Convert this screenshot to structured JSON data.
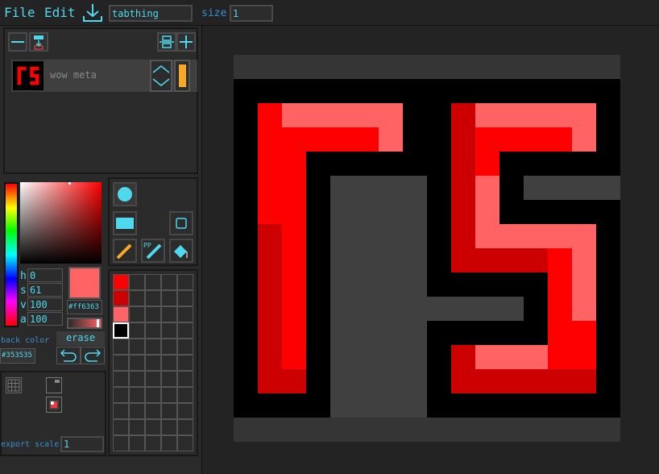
{
  "menu": {
    "file": "File",
    "edit": "Edit"
  },
  "toolbar": {
    "download_icon": "download-icon",
    "project_name": "tabthing",
    "size_label": "size",
    "size_value": "1"
  },
  "layers": {
    "toolbar": {
      "remove_icon": "minus-icon",
      "merge_icon": "merge-down-icon",
      "swap_icon": "swap-icon",
      "add_icon": "plus-icon"
    },
    "items": [
      {
        "name": "wow meta",
        "visible_color": "#f8a825"
      }
    ]
  },
  "color_picker": {
    "h_label": "h",
    "h": "0",
    "s_label": "s",
    "s": "61",
    "v_label": "v",
    "v": "100",
    "a_label": "a",
    "a": "100",
    "current_hex": "#ff6363",
    "back_color_label": "back color",
    "back_color_hex": "#353535"
  },
  "actions": {
    "erase": "erase",
    "undo_icon": "undo-icon",
    "redo_icon": "redo-icon"
  },
  "tools": [
    {
      "icon": "circle-brush-icon",
      "selected": true
    },
    {
      "icon": "square-brush-icon",
      "selected": false
    },
    {
      "icon": "small-square-brush-icon",
      "selected": false
    },
    {
      "icon": "pencil-icon",
      "selected": false
    },
    {
      "icon": "pixel-perfect-pencil-icon",
      "label": "PP",
      "selected": false
    },
    {
      "icon": "paint-bucket-icon",
      "selected": false
    }
  ],
  "palette": {
    "colors": [
      "#ff0000",
      "#cc0000",
      "#ff6363",
      "#000000"
    ],
    "selected_index": 3
  },
  "view": {
    "grid_icon": "grid-icon",
    "toggle_icon": "layer-toggle-icon",
    "color_icon": "color-preview-icon"
  },
  "export": {
    "label": "export scale:",
    "value": "1"
  },
  "canvas": {
    "background": "#000000",
    "border_color": "#353535",
    "colors": {
      "red": "#ff0000",
      "dark_red": "#cc0000",
      "light_red": "#ff6363",
      "gray": "#404040"
    }
  }
}
